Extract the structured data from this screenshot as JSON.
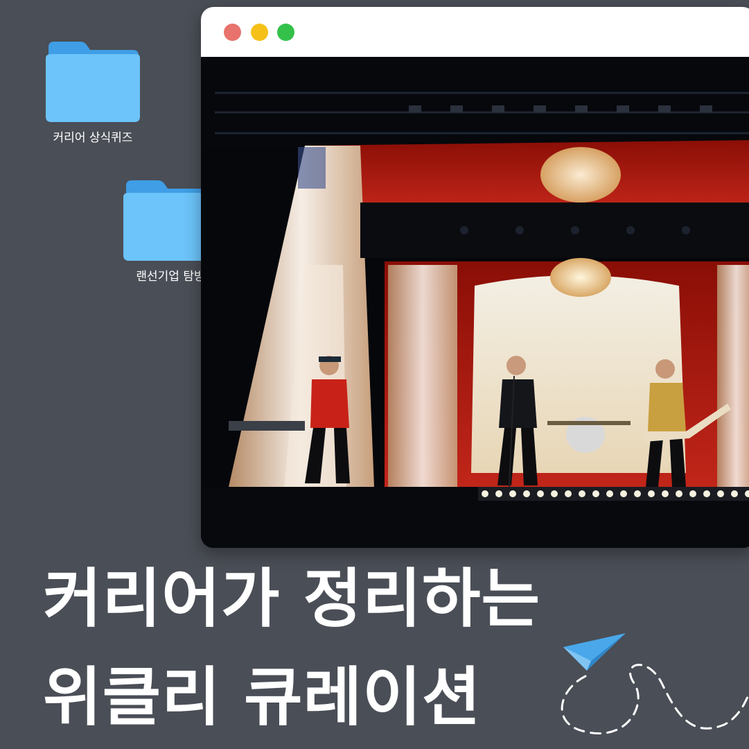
{
  "desktop": {
    "folders": [
      {
        "label": "커리어 상식퀴즈",
        "icon": "folder-icon"
      },
      {
        "label": "랜선기업 탐방",
        "icon": "folder-icon"
      }
    ]
  },
  "browser": {
    "controls": [
      "close",
      "minimize",
      "maximize"
    ],
    "control_colors": [
      "#e8736c",
      "#f5c118",
      "#34c14a"
    ],
    "image_alt_semantic": "concert-photo"
  },
  "headline": {
    "line1": "커리어가 정리하는",
    "line2": "위클리 큐레이션"
  },
  "decoration": {
    "icon": "paper-plane-icon",
    "accent_color": "#4aa8ea"
  }
}
